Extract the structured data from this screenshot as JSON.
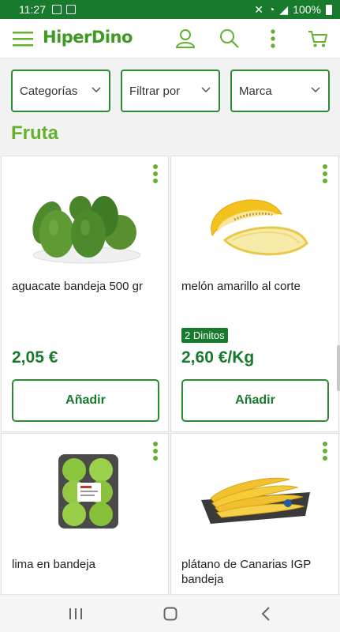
{
  "status_bar": {
    "time": "11:27",
    "battery": "100%"
  },
  "header": {
    "logo": "HiperDino",
    "icons": [
      "hamburger-menu-icon",
      "user-icon",
      "search-icon",
      "more-vertical-icon",
      "cart-icon"
    ]
  },
  "filters": [
    {
      "label": "Categorías"
    },
    {
      "label": "Filtrar por"
    },
    {
      "label": "Marca"
    }
  ],
  "section_title": "Fruta",
  "products": [
    {
      "name": "aguacate bandeja 500 gr",
      "badge": "",
      "price": "2,05 €",
      "button": "Añadir"
    },
    {
      "name": "melón amarillo al corte",
      "badge": "2 Dinitos",
      "price": "2,60 €/Kg",
      "button": "Añadir"
    },
    {
      "name": "lima en bandeja",
      "badge": "",
      "price": "",
      "button": ""
    },
    {
      "name": "plátano de Canarias IGP bandeja",
      "badge": "",
      "price": "",
      "button": ""
    }
  ],
  "colors": {
    "brand_green": "#177a2c",
    "accent_green": "#63b12d",
    "border_green": "#2f8a35"
  }
}
